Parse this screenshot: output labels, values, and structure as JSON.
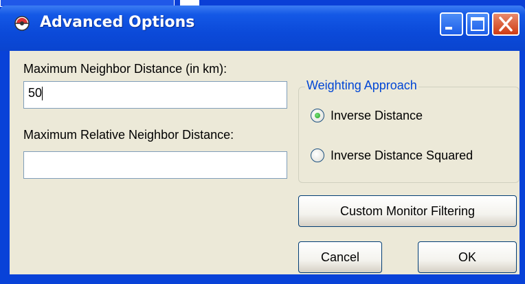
{
  "window": {
    "title": "Advanced Options"
  },
  "fields": {
    "max_distance_label": "Maximum Neighbor Distance (in km):",
    "max_distance_value": "50",
    "max_relative_label": "Maximum Relative Neighbor Distance:",
    "max_relative_value": ""
  },
  "weighting": {
    "group_title": "Weighting Approach",
    "options": [
      {
        "label": "Inverse Distance",
        "selected": true
      },
      {
        "label": "Inverse Distance Squared",
        "selected": false
      }
    ]
  },
  "buttons": {
    "custom_filter": "Custom Monitor Filtering",
    "cancel": "Cancel",
    "ok": "OK"
  },
  "colors": {
    "titlebar": "#0b4ad9",
    "client_bg": "#ece9d8",
    "group_title": "#0046d5",
    "close_button": "#cf3b12"
  }
}
